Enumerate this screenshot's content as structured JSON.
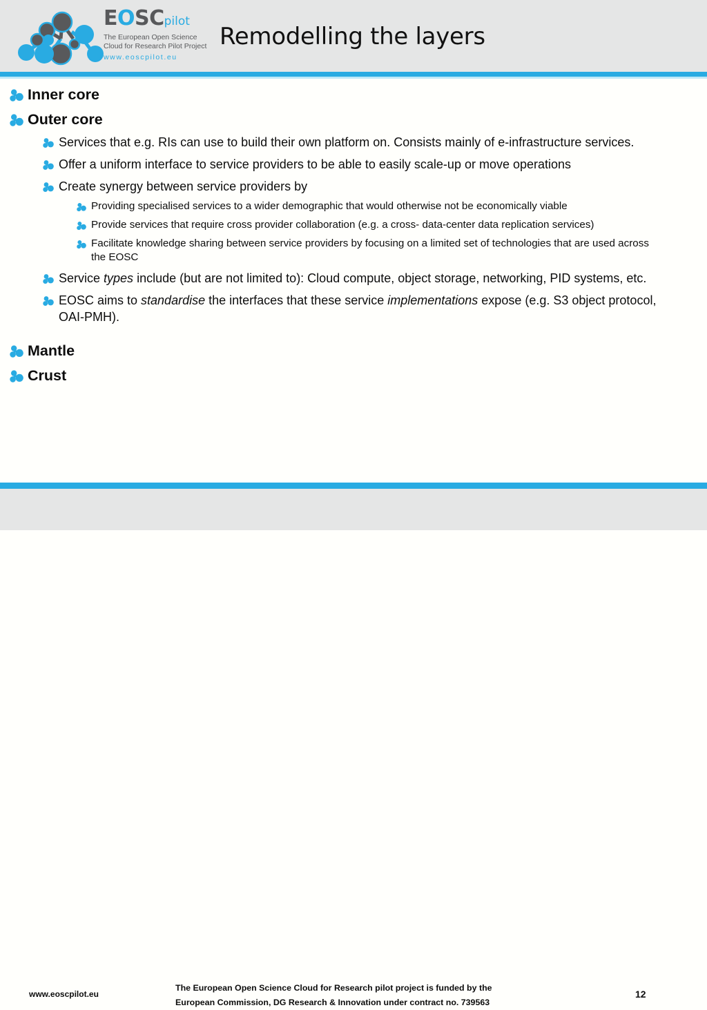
{
  "header": {
    "title": "Remodelling the layers",
    "logo": {
      "icon_name": "eoscpilot-molecule-logo",
      "wordmark_e": "E",
      "wordmark_o": "O",
      "wordmark_sc": "SC",
      "wordmark_pilot": "pilot",
      "tagline_line1": "The European Open Science",
      "tagline_line2": "Cloud for Research Pilot Project",
      "url": "www.eoscpilot.eu"
    },
    "accent_color": "#29abe2",
    "band_color": "#e5e6e6"
  },
  "content": {
    "bullet_icon_name": "molecule-bullet-icon",
    "bullet_color": "#29abe2",
    "items": [
      {
        "level": 1,
        "text": "Inner core"
      },
      {
        "level": 1,
        "text": "Outer core"
      },
      {
        "level": 2,
        "text": "Services that e.g. RIs can use to build their own platform on. Consists mainly of e-infrastructure services."
      },
      {
        "level": 2,
        "text": "Offer a uniform interface to service providers to be able to easily scale-up or move operations"
      },
      {
        "level": 2,
        "text": "Create synergy between service providers by"
      },
      {
        "level": 3,
        "text": "Providing specialised services to a wider demographic that would otherwise not be economically viable"
      },
      {
        "level": 3,
        "text": "Provide services that require cross provider collaboration (e.g. a cross- data-center data replication services)"
      },
      {
        "level": 3,
        "text": "Facilitate knowledge sharing between service providers by focusing on a limited set of technologies that are used across the EOSC"
      },
      {
        "level": 2,
        "html": "Service <em>types</em> include (but are not limited to): Cloud compute, object storage, networking, PID systems, etc.",
        "text": "Service types include (but are not limited to): Cloud compute, object storage, networking, PID systems, etc."
      },
      {
        "level": 2,
        "html": "EOSC aims to <em>standardise</em> the interfaces that these service <em>implementations</em> expose (e.g. S3 object protocol, OAI-PMH).",
        "text": "EOSC aims to standardise the interfaces that these service implementations expose (e.g. S3 object protocol, OAI-PMH)."
      },
      {
        "level": 1,
        "text": "Mantle"
      },
      {
        "level": 1,
        "text": "Crust"
      }
    ]
  },
  "footer": {
    "url": "www.eoscpilot.eu",
    "statement_line1": "The European Open Science Cloud for Research pilot project is funded by the",
    "statement_line2": "European Commission, DG Research & Innovation under contract no. 739563",
    "page_number": "12"
  }
}
